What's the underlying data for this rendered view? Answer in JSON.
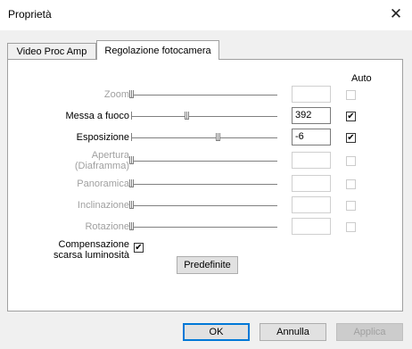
{
  "window": {
    "title": "Proprietà",
    "close_glyph": "✕"
  },
  "tabs": [
    {
      "label": "Video Proc Amp",
      "active": false
    },
    {
      "label": "Regolazione fotocamera",
      "active": true
    }
  ],
  "panel": {
    "auto_header": "Auto",
    "rows": [
      {
        "label": "Zoom",
        "enabled": false,
        "value": "",
        "slider_fraction": 0.0,
        "auto": false
      },
      {
        "label": "Messa a fuoco",
        "enabled": true,
        "value": "392",
        "slider_fraction": 0.38,
        "auto": true
      },
      {
        "label": "Esposizione",
        "enabled": true,
        "value": "-6",
        "slider_fraction": 0.59,
        "auto": true
      },
      {
        "label_line1": "Apertura",
        "label_line2": "(Diaframma)",
        "enabled": false,
        "value": "",
        "slider_fraction": 0.0,
        "auto": false
      },
      {
        "label": "Panoramica",
        "enabled": false,
        "value": "",
        "slider_fraction": 0.0,
        "auto": false
      },
      {
        "label": "Inclinazione",
        "enabled": false,
        "value": "",
        "slider_fraction": 0.0,
        "auto": false
      },
      {
        "label": "Rotazione",
        "enabled": false,
        "value": "",
        "slider_fraction": 0.0,
        "auto": false
      }
    ],
    "low_light": {
      "label_line1": "Compensazione",
      "label_line2": "scarsa luminosità",
      "checked": true
    },
    "default_button": "Predefinite"
  },
  "footer": {
    "ok": "OK",
    "cancel": "Annulla",
    "apply": "Applica"
  },
  "check_glyph": "✔"
}
